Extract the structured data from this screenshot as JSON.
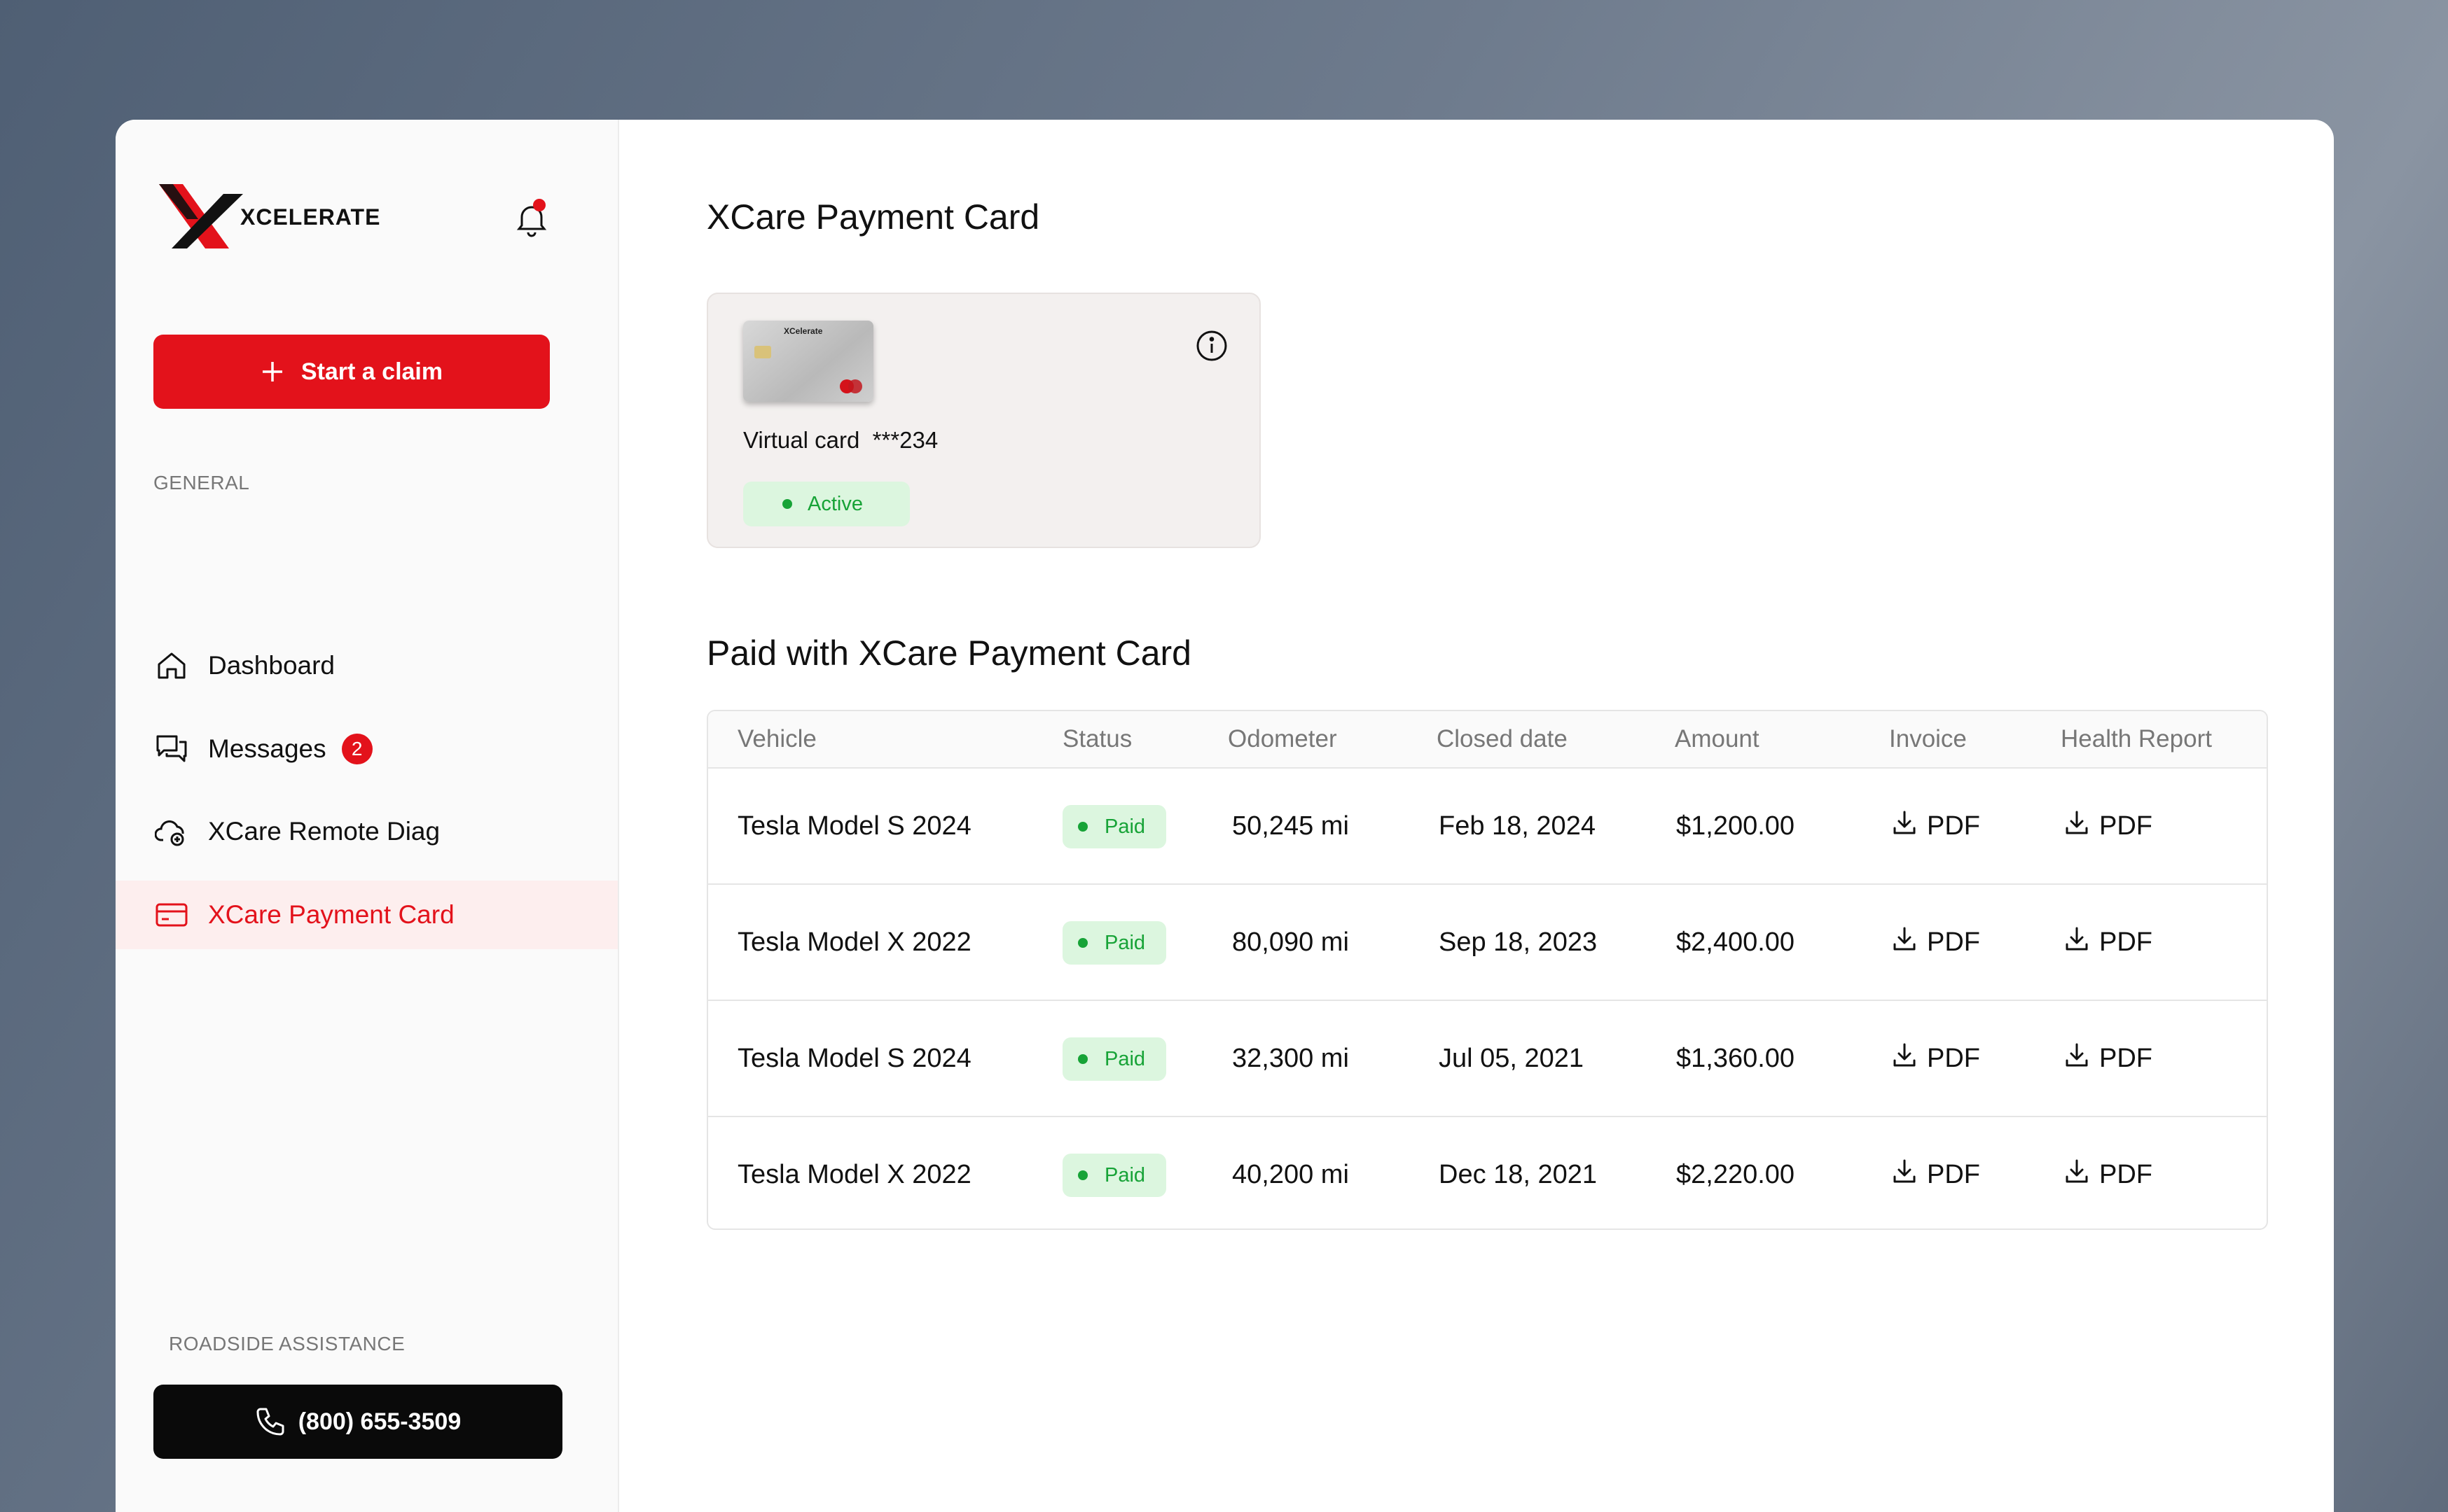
{
  "brand": {
    "name": "XCELERATE"
  },
  "sidebar": {
    "start_claim_label": "Start a claim",
    "section_general": "GENERAL",
    "items": [
      {
        "label": "Dashboard",
        "icon": "home-icon"
      },
      {
        "label": "Messages",
        "icon": "chat-icon",
        "badge": "2"
      },
      {
        "label": "XCare Remote Diag",
        "icon": "cloud-diag-icon"
      },
      {
        "label": "XCare Payment Card",
        "icon": "card-icon",
        "active": true
      }
    ],
    "section_roadside": "ROADSIDE ASSISTANCE",
    "phone": "(800) 655-3509"
  },
  "main": {
    "title": "XCare Payment Card",
    "card": {
      "thumb_brand": "XCelerate",
      "label": "Virtual card  ***234",
      "status": "Active"
    },
    "table_title": "Paid with XCare Payment Card",
    "columns": [
      "Vehicle",
      "Status",
      "Odometer",
      "Closed date",
      "Amount",
      "Invoice",
      "Health Report"
    ],
    "rows": [
      {
        "vehicle": "Tesla Model S 2024",
        "status": "Paid",
        "odometer": "50,245 mi",
        "closed": "Feb 18, 2024",
        "amount": "$1,200.00",
        "invoice": "PDF",
        "health": "PDF"
      },
      {
        "vehicle": "Tesla Model X 2022",
        "status": "Paid",
        "odometer": "80,090 mi",
        "closed": "Sep 18, 2023",
        "amount": "$2,400.00",
        "invoice": "PDF",
        "health": "PDF"
      },
      {
        "vehicle": "Tesla Model S 2024",
        "status": "Paid",
        "odometer": "32,300 mi",
        "closed": "Jul 05, 2021",
        "amount": "$1,360.00",
        "invoice": "PDF",
        "health": "PDF"
      },
      {
        "vehicle": "Tesla Model X 2022",
        "status": "Paid",
        "odometer": "40,200 mi",
        "closed": "Dec 18, 2021",
        "amount": "$2,220.00",
        "invoice": "PDF",
        "health": "PDF"
      }
    ]
  },
  "colors": {
    "accent": "#e3121b",
    "success": "#17a337",
    "success_bg": "#dcf6df"
  }
}
